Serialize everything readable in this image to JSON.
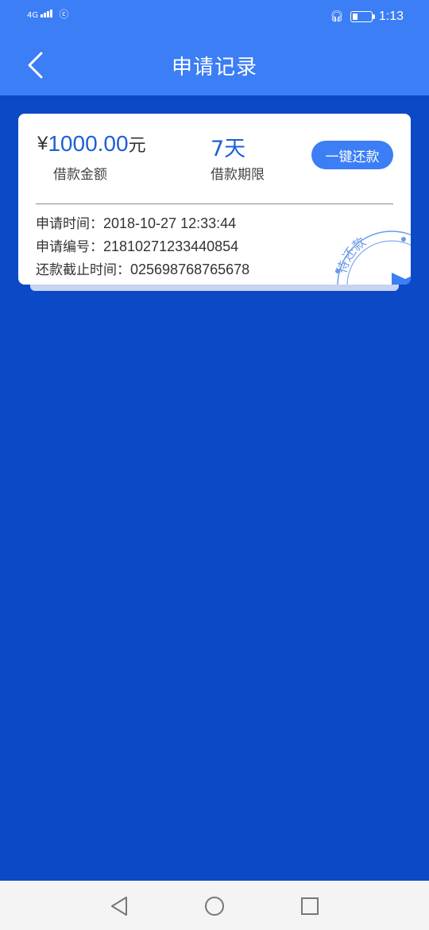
{
  "status_bar": {
    "network": "4G",
    "time": "1:13"
  },
  "header": {
    "title": "申请记录"
  },
  "record": {
    "currency_symbol": "¥",
    "amount": "1000.00",
    "amount_unit": "元",
    "amount_label": "借款金额",
    "term": "7天",
    "term_label": "借款期限",
    "repay_button": "一键还款",
    "apply_time_label": "申请时间：",
    "apply_time": "2018-10-27 12:33:44",
    "apply_no_label": "申请编号：",
    "apply_no": "21810271233440854",
    "deadline_label": "还款截止时间：",
    "deadline": "025698768765678",
    "stamp_text": "待还款"
  },
  "colors": {
    "header_bg": "#3b7ef5",
    "page_bg": "#0c49c6",
    "accent": "#1d5fd6"
  }
}
